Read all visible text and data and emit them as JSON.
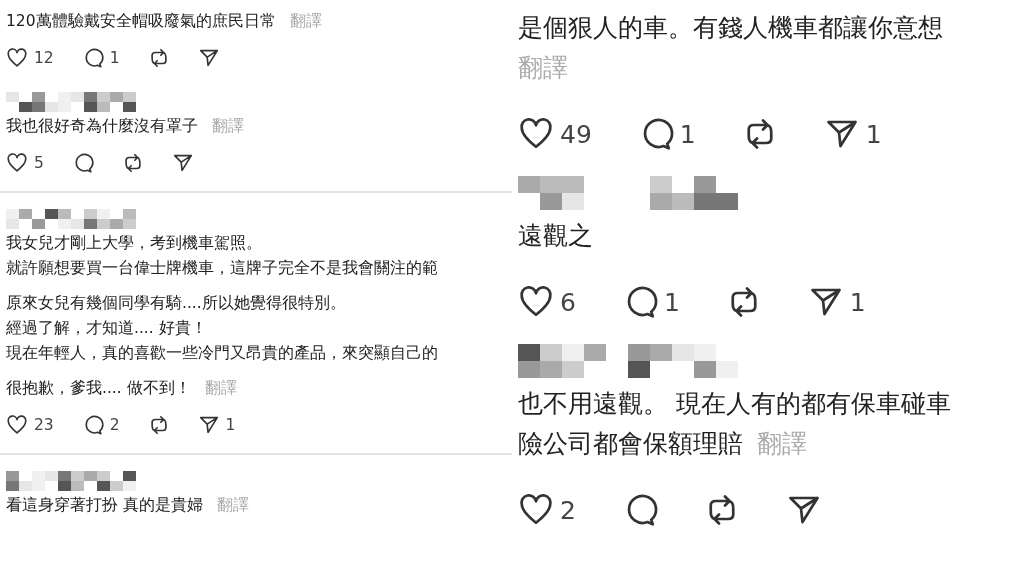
{
  "panels": [
    {
      "comments": [
        {
          "divider_above": false,
          "paragraphs": [
            [
              "120萬體驗戴安全帽吸廢氣的庶民日常"
            ]
          ],
          "translate": "翻譯",
          "actions": [
            {
              "kind": "like",
              "count": "12"
            },
            {
              "kind": "reply",
              "count": "1"
            },
            {
              "kind": "repost"
            },
            {
              "kind": "share"
            }
          ]
        },
        {
          "divider_above": false,
          "username": {
            "kind": "picture"
          },
          "paragraphs": [
            [
              "我也很好奇為什麼沒有罩子"
            ]
          ],
          "translate": "翻譯",
          "actions": [
            {
              "kind": "like",
              "count": "5"
            },
            {
              "kind": "reply"
            },
            {
              "kind": "repost"
            },
            {
              "kind": "share"
            }
          ]
        },
        {
          "divider_above": true,
          "username": {
            "kind": "picture"
          },
          "paragraphs": [
            [
              "我女兒才剛上大學，考到機車駕照。",
              "就許願想要買一台偉士牌機車，這牌子完全不是我會關注的範"
            ],
            [
              "原來女兒有幾個同學有騎....所以她覺得很特別。",
              "經過了解，才知道.... 好貴！",
              "現在年輕人，真的喜歡一些冷門又昂貴的產品，來突顯自己的"
            ],
            [
              "很抱歉，爹我.... 做不到！"
            ]
          ],
          "translate": "翻譯",
          "actions": [
            {
              "kind": "like",
              "count": "23"
            },
            {
              "kind": "reply",
              "count": "2"
            },
            {
              "kind": "repost"
            },
            {
              "kind": "share",
              "count": "1"
            }
          ]
        },
        {
          "divider_above": true,
          "username": {
            "kind": "picture"
          },
          "paragraphs": [
            [
              "看這身穿著打扮 真的是貴婦"
            ]
          ],
          "translate": "翻譯"
        }
      ]
    },
    {
      "comments": [
        {
          "divider_above": false,
          "paragraphs": [
            [
              "是個狠人的車。有錢人機車都讓你意想"
            ]
          ],
          "translate": "翻譯",
          "translate_own_line": true,
          "actions": [
            {
              "kind": "like",
              "count": "49"
            },
            {
              "kind": "reply",
              "count": "1"
            },
            {
              "kind": "repost"
            },
            {
              "kind": "share",
              "count": "1"
            }
          ]
        },
        {
          "divider_above": false,
          "username": {
            "kind": "picture"
          },
          "paragraphs": [
            [
              "遠觀之"
            ]
          ],
          "actions": [
            {
              "kind": "like",
              "count": "6"
            },
            {
              "kind": "reply",
              "count": "1"
            },
            {
              "kind": "repost"
            },
            {
              "kind": "share",
              "count": "1"
            }
          ]
        },
        {
          "divider_above": false,
          "username": {
            "kind": "picture"
          },
          "paragraphs": [
            [
              "也不用遠觀。 現在人有的都有保車碰車",
              "險公司都會保額理賠"
            ]
          ],
          "translate": "翻譯",
          "actions": [
            {
              "kind": "like",
              "count": "2"
            },
            {
              "kind": "reply"
            },
            {
              "kind": "repost"
            },
            {
              "kind": "share"
            }
          ]
        }
      ]
    }
  ]
}
